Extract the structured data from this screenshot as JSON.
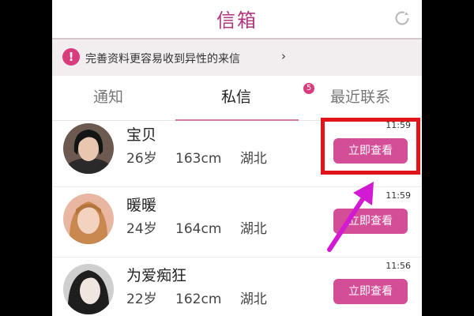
{
  "header": {
    "title": "信箱",
    "refresh_icon": "refresh-icon"
  },
  "notice": {
    "icon": "exclamation-icon",
    "text": "完善资料更容易收到异性的来信",
    "chevron": "›"
  },
  "tabs": [
    {
      "label": "通知"
    },
    {
      "label": "私信",
      "badge": "5"
    },
    {
      "label": "最近联系"
    }
  ],
  "messages": [
    {
      "name": "宝贝",
      "age": "26岁",
      "height": "163cm",
      "location": "湖北",
      "time": "11:59",
      "action": "立即查看"
    },
    {
      "name": "暖暖",
      "age": "24岁",
      "height": "164cm",
      "location": "湖北",
      "time": "11:59",
      "action": "立即查看"
    },
    {
      "name": "为爱痴狂",
      "age": "22岁",
      "height": "162cm",
      "location": "湖北",
      "time": "11:56",
      "action": "立即查看"
    }
  ],
  "colors": {
    "brand": "#b0357e",
    "button": "#d44d97",
    "highlight": "#e0141b",
    "arrow": "#d21ad2"
  }
}
